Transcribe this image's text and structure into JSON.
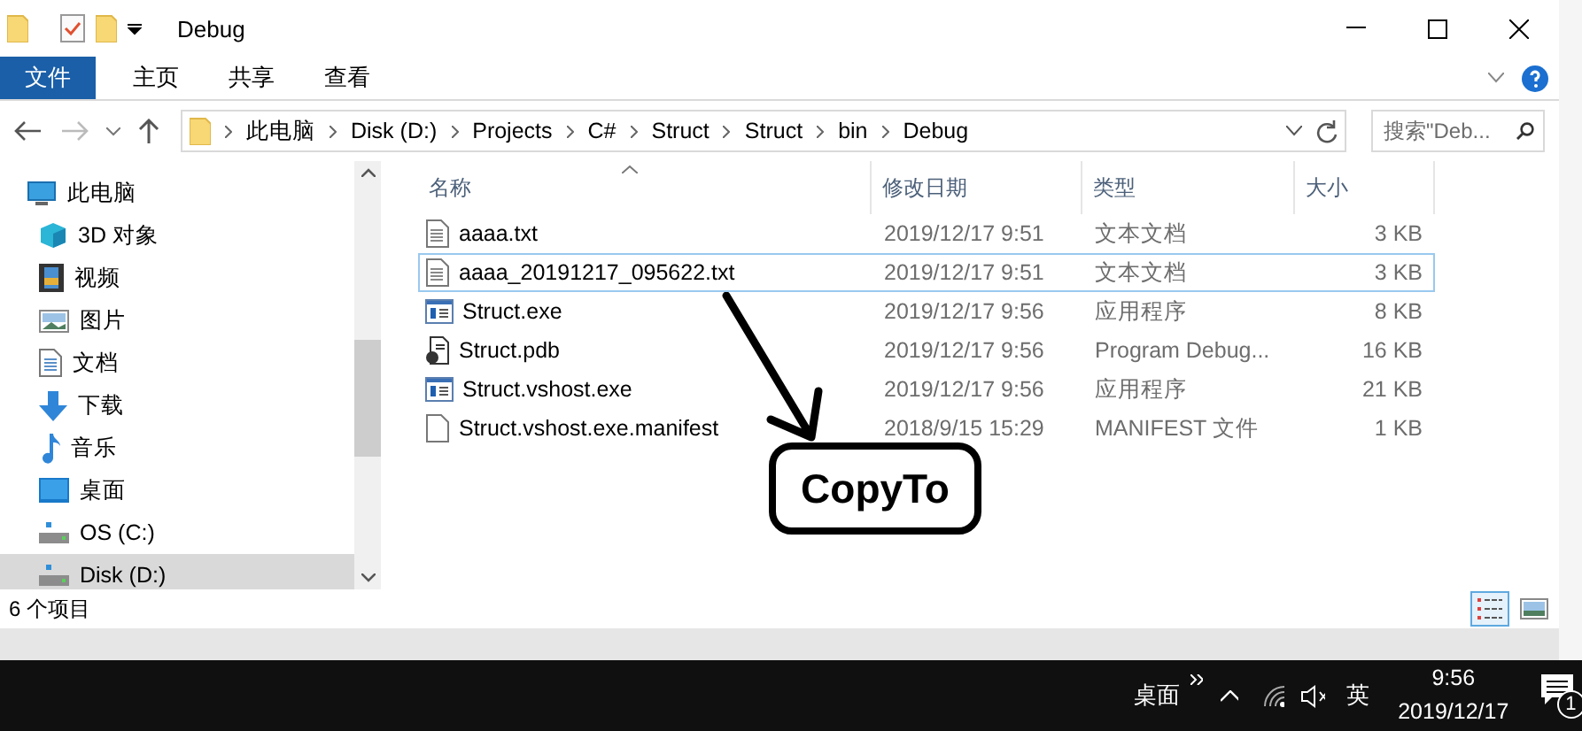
{
  "title_bar": {
    "title": "Debug"
  },
  "ribbon": {
    "tabs": [
      {
        "label": "文件",
        "selected": true
      },
      {
        "label": "主页",
        "selected": false
      },
      {
        "label": "共享",
        "selected": false
      },
      {
        "label": "查看",
        "selected": false
      }
    ]
  },
  "address_bar": {
    "breadcrumbs": [
      "此电脑",
      "Disk (D:)",
      "Projects",
      "C#",
      "Struct",
      "Struct",
      "bin",
      "Debug"
    ],
    "search": {
      "placeholder": "搜索\"Deb..."
    }
  },
  "nav": {
    "items": [
      {
        "label": "此电脑",
        "kind": "pc",
        "selected": false
      },
      {
        "label": "3D 对象",
        "kind": "cube",
        "selected": false
      },
      {
        "label": "视频",
        "kind": "film",
        "selected": false
      },
      {
        "label": "图片",
        "kind": "image",
        "selected": false
      },
      {
        "label": "文档",
        "kind": "doc",
        "selected": false
      },
      {
        "label": "下载",
        "kind": "download",
        "selected": false
      },
      {
        "label": "音乐",
        "kind": "music",
        "selected": false
      },
      {
        "label": "桌面",
        "kind": "desktop",
        "selected": false
      },
      {
        "label": "OS (C:)",
        "kind": "drive",
        "selected": false
      },
      {
        "label": "Disk (D:)",
        "kind": "drive",
        "selected": true
      }
    ]
  },
  "files": {
    "columns": [
      "名称",
      "修改日期",
      "类型",
      "大小"
    ],
    "rows": [
      {
        "name": "aaaa.txt",
        "modified": "2019/12/17 9:51",
        "type": "文本文档",
        "size": "3 KB",
        "kind": "text",
        "focused": false
      },
      {
        "name": "aaaa_20191217_095622.txt",
        "modified": "2019/12/17 9:51",
        "type": "文本文档",
        "size": "3 KB",
        "kind": "text",
        "focused": true
      },
      {
        "name": "Struct.exe",
        "modified": "2019/12/17 9:56",
        "type": "应用程序",
        "size": "8 KB",
        "kind": "exe",
        "focused": false
      },
      {
        "name": "Struct.pdb",
        "modified": "2019/12/17 9:56",
        "type": "Program Debug...",
        "size": "16 KB",
        "kind": "pdb",
        "focused": false
      },
      {
        "name": "Struct.vshost.exe",
        "modified": "2019/12/17 9:56",
        "type": "应用程序",
        "size": "21 KB",
        "kind": "exe",
        "focused": false
      },
      {
        "name": "Struct.vshost.exe.manifest",
        "modified": "2018/9/15 15:29",
        "type": "MANIFEST 文件",
        "size": "1 KB",
        "kind": "blank",
        "focused": false
      }
    ]
  },
  "annotation": {
    "label": "CopyTo"
  },
  "status_bar": {
    "count": "6 个项目",
    "views": [
      {
        "kind": "details",
        "selected": true
      },
      {
        "kind": "thumbnails",
        "selected": false
      }
    ]
  },
  "taskbar": {
    "desktop": "桌面",
    "ime": "英",
    "time": "9:56",
    "date": "2019/12/17",
    "notifications": "1"
  }
}
